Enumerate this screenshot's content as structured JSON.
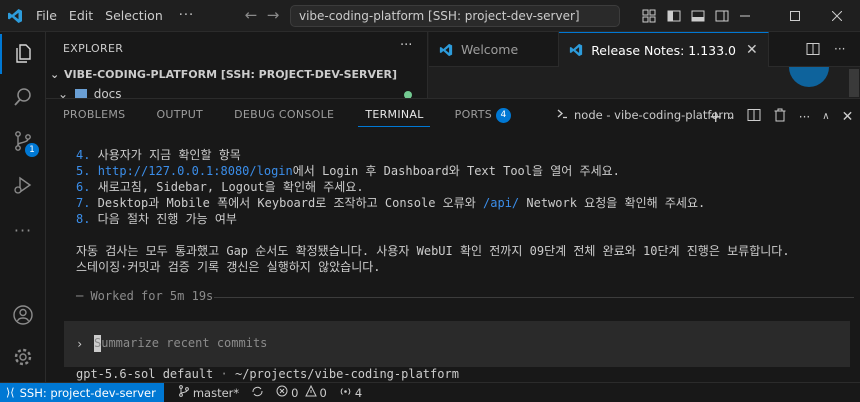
{
  "titlebar": {
    "menus": [
      "File",
      "Edit",
      "Selection"
    ],
    "more": "···",
    "search_text": "vibe-coding-platform [SSH: project-dev-server]",
    "accent": "#0078d4"
  },
  "activity": {
    "scm_badge": "1",
    "icons": [
      "files-icon",
      "search-icon",
      "source-control-icon",
      "run-debug-icon",
      "more-icon",
      "account-icon",
      "settings-icon"
    ]
  },
  "explorer": {
    "title": "EXPLORER",
    "more": "···",
    "root_folder": "VIBE-CODING-PLATFORM [SSH: PROJECT-DEV-SERVER]",
    "item": "docs"
  },
  "editor": {
    "tabs": [
      {
        "label": "Welcome"
      },
      {
        "label": "Release Notes: 1.133.0"
      }
    ]
  },
  "panel": {
    "tabs": [
      "PROBLEMS",
      "OUTPUT",
      "DEBUG CONSOLE",
      "TERMINAL",
      "PORTS"
    ],
    "ports_badge": "4",
    "terminal_name": "node - vibe-coding-platform",
    "lines": {
      "l4_num": "4.",
      "l4_text": " 사용자가 지금 확인할 항목",
      "l5_num": "5.",
      "l5_link": "http://127.0.0.1:8080/login",
      "l5_text": "에서 Login 후 Dashboard와 Text Tool을 열어 주세요.",
      "l6_num": "6.",
      "l6_text": " 새로고침, Sidebar, Logout을 확인해 주세요.",
      "l7_num": "7.",
      "l7_text_a": " Desktop과 Mobile 폭에서 Keyboard로 조작하고 Console 오류와 ",
      "l7_path": "/api/",
      "l7_text_b": " Network 요청을 확인해 주세요.",
      "l8_num": "8.",
      "l8_text": " 다음 절차 진행 가능 여부",
      "summary_1": "자동 검사는 모두 통과했고 Gap 순서도 확정됐습니다. 사용자 WebUI 확인 전까지 09단계 전체 완료와 10단계 진행은 보류합니다.",
      "summary_2": "스테이징·커밋과 검증 기록 갱신은 실행하지 않았습니다."
    },
    "worked": "─ Worked for 5m 19s",
    "prompt_caret": "›",
    "prompt_placeholder": "Summarize recent commits",
    "model_name": "gpt-5.6-sol default",
    "model_sep": " · ",
    "model_path": "~/projects/vibe-coding-platform"
  },
  "statusbar": {
    "remote": "SSH: project-dev-server",
    "branch": "master*",
    "errors": "0",
    "warnings": "0",
    "ports": "4"
  }
}
